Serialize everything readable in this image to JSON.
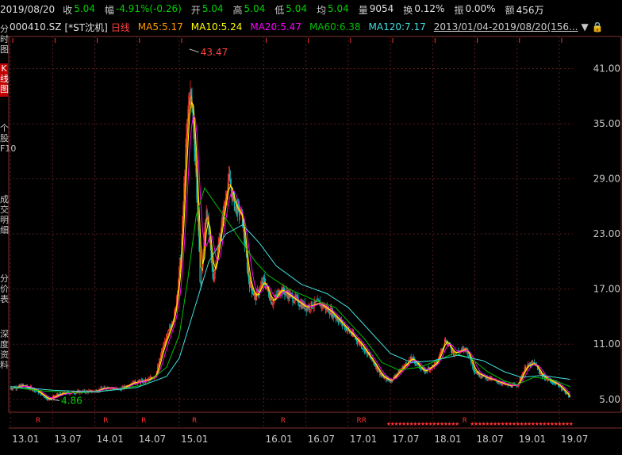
{
  "header": {
    "date": "2019/08/20",
    "close_label": "收",
    "close": "5.04",
    "change_label": "幅",
    "change": "-4.91%(-0.26)",
    "open_label": "开",
    "open": "5.04",
    "high_label": "高",
    "high": "5.04",
    "low_label": "低",
    "low": "5.04",
    "avg_label": "均",
    "avg": "5.04",
    "volume_label": "量",
    "volume": "9054",
    "turnover_label": "换",
    "turnover": "0.12%",
    "amplitude_label": "振",
    "amplitude": "0.00%",
    "amount_label": "额",
    "amount": "456万"
  },
  "ma_bar": {
    "code": "000410.SZ",
    "name": "[*ST沈机]",
    "period": "日线",
    "ma5": "MA5:5.17",
    "ma10": "MA10:5.24",
    "ma20": "MA20:5.47",
    "ma60": "MA60:6.38",
    "ma120": "MA120:7.17",
    "range": "2013/01/04-2019/08/20(156..."
  },
  "left_tabs": [
    "分时图",
    "K线图",
    "个股F10",
    "成交明细",
    "分价表",
    "深度资料"
  ],
  "colors": {
    "ma5": "#ff9900",
    "ma10": "#ffff00",
    "ma20": "#ff00ff",
    "ma60": "#00c000",
    "ma120": "#40e0e0",
    "up": "#ff3030",
    "down": "#00c0c0"
  },
  "chart_data": {
    "type": "line",
    "ylim": [
      3.6,
      44.5
    ],
    "y_ticks": [
      "41.00",
      "35.00",
      "29.00",
      "23.00",
      "17.00",
      "11.00",
      "5.00"
    ],
    "y_tick_values": [
      41,
      35,
      29,
      23,
      17,
      11,
      5
    ],
    "x_ticks": [
      "13.01",
      "13.07",
      "14.01",
      "14.07",
      "15.01",
      "16.01",
      "16.07",
      "17.01",
      "17.07",
      "18.01",
      "18.07",
      "19.01",
      "19.07"
    ],
    "x_tick_values": [
      2013.0,
      2013.5,
      2014.0,
      2014.5,
      2015.0,
      2016.0,
      2016.5,
      2017.0,
      2017.5,
      2018.0,
      2018.5,
      2019.0,
      2019.5
    ],
    "xlim": [
      2012.98,
      2019.66
    ],
    "annotations": {
      "high": "43.47",
      "low": "4.86"
    },
    "r_markers": [
      "R",
      "R",
      "R",
      "R",
      "R",
      "RR",
      "R"
    ],
    "r_marker_x": [
      2013.3,
      2014.1,
      2014.55,
      2015.15,
      2016.2,
      2017.1,
      2018.35
    ],
    "price": [
      [
        2013.0,
        6.2
      ],
      [
        2013.15,
        6.5
      ],
      [
        2013.3,
        6.0
      ],
      [
        2013.45,
        5.0
      ],
      [
        2013.6,
        5.6
      ],
      [
        2013.8,
        5.8
      ],
      [
        2014.0,
        5.9
      ],
      [
        2014.15,
        6.3
      ],
      [
        2014.3,
        6.1
      ],
      [
        2014.45,
        6.8
      ],
      [
        2014.6,
        7.0
      ],
      [
        2014.72,
        7.6
      ],
      [
        2014.8,
        10.5
      ],
      [
        2014.88,
        12.5
      ],
      [
        2014.95,
        14.5
      ],
      [
        2015.02,
        21.0
      ],
      [
        2015.08,
        33.0
      ],
      [
        2015.12,
        39.0
      ],
      [
        2015.16,
        36.0
      ],
      [
        2015.2,
        29.0
      ],
      [
        2015.25,
        17.0
      ],
      [
        2015.32,
        26.0
      ],
      [
        2015.4,
        18.0
      ],
      [
        2015.5,
        24.0
      ],
      [
        2015.58,
        29.0
      ],
      [
        2015.66,
        26.0
      ],
      [
        2015.74,
        25.0
      ],
      [
        2015.82,
        18.0
      ],
      [
        2015.9,
        16.0
      ],
      [
        2016.0,
        18.0
      ],
      [
        2016.1,
        15.5
      ],
      [
        2016.2,
        17.0
      ],
      [
        2016.35,
        16.0
      ],
      [
        2016.5,
        15.0
      ],
      [
        2016.65,
        15.5
      ],
      [
        2016.8,
        14.5
      ],
      [
        2016.95,
        13.0
      ],
      [
        2017.05,
        12.0
      ],
      [
        2017.15,
        11.0
      ],
      [
        2017.3,
        9.0
      ],
      [
        2017.4,
        7.5
      ],
      [
        2017.5,
        7.0
      ],
      [
        2017.6,
        8.0
      ],
      [
        2017.75,
        9.5
      ],
      [
        2017.9,
        8.0
      ],
      [
        2018.05,
        9.0
      ],
      [
        2018.15,
        11.5
      ],
      [
        2018.25,
        10.0
      ],
      [
        2018.4,
        10.5
      ],
      [
        2018.5,
        8.0
      ],
      [
        2018.6,
        7.5
      ],
      [
        2018.75,
        7.0
      ],
      [
        2018.9,
        6.5
      ],
      [
        2019.0,
        6.5
      ],
      [
        2019.1,
        8.5
      ],
      [
        2019.2,
        9.0
      ],
      [
        2019.3,
        7.5
      ],
      [
        2019.4,
        7.0
      ],
      [
        2019.5,
        6.5
      ],
      [
        2019.6,
        5.5
      ],
      [
        2019.63,
        5.04
      ]
    ],
    "ma60": [
      [
        2013.0,
        6.3
      ],
      [
        2013.4,
        5.9
      ],
      [
        2013.8,
        5.7
      ],
      [
        2014.2,
        6.0
      ],
      [
        2014.6,
        6.6
      ],
      [
        2014.85,
        8.5
      ],
      [
        2015.0,
        12.0
      ],
      [
        2015.1,
        18.0
      ],
      [
        2015.2,
        25.0
      ],
      [
        2015.3,
        28.0
      ],
      [
        2015.45,
        26.0
      ],
      [
        2015.6,
        24.0
      ],
      [
        2015.75,
        22.0
      ],
      [
        2015.9,
        20.0
      ],
      [
        2016.05,
        18.5
      ],
      [
        2016.3,
        17.0
      ],
      [
        2016.6,
        15.8
      ],
      [
        2016.85,
        15.0
      ],
      [
        2017.0,
        13.5
      ],
      [
        2017.2,
        11.5
      ],
      [
        2017.4,
        9.0
      ],
      [
        2017.6,
        8.2
      ],
      [
        2017.85,
        8.5
      ],
      [
        2018.05,
        9.2
      ],
      [
        2018.25,
        10.0
      ],
      [
        2018.45,
        9.5
      ],
      [
        2018.65,
        8.0
      ],
      [
        2018.85,
        7.0
      ],
      [
        2019.0,
        6.6
      ],
      [
        2019.2,
        7.4
      ],
      [
        2019.4,
        7.2
      ],
      [
        2019.63,
        6.38
      ]
    ],
    "ma120": [
      [
        2013.0,
        6.4
      ],
      [
        2013.5,
        6.0
      ],
      [
        2014.0,
        5.8
      ],
      [
        2014.5,
        6.3
      ],
      [
        2014.85,
        7.5
      ],
      [
        2015.0,
        9.5
      ],
      [
        2015.15,
        14.0
      ],
      [
        2015.35,
        20.0
      ],
      [
        2015.55,
        23.0
      ],
      [
        2015.75,
        24.0
      ],
      [
        2015.95,
        22.0
      ],
      [
        2016.15,
        19.5
      ],
      [
        2016.45,
        17.5
      ],
      [
        2016.75,
        16.5
      ],
      [
        2017.0,
        15.0
      ],
      [
        2017.25,
        12.5
      ],
      [
        2017.5,
        10.0
      ],
      [
        2017.75,
        9.0
      ],
      [
        2018.0,
        9.2
      ],
      [
        2018.3,
        9.8
      ],
      [
        2018.6,
        9.2
      ],
      [
        2018.85,
        8.0
      ],
      [
        2019.05,
        7.4
      ],
      [
        2019.3,
        7.6
      ],
      [
        2019.63,
        7.17
      ]
    ]
  }
}
